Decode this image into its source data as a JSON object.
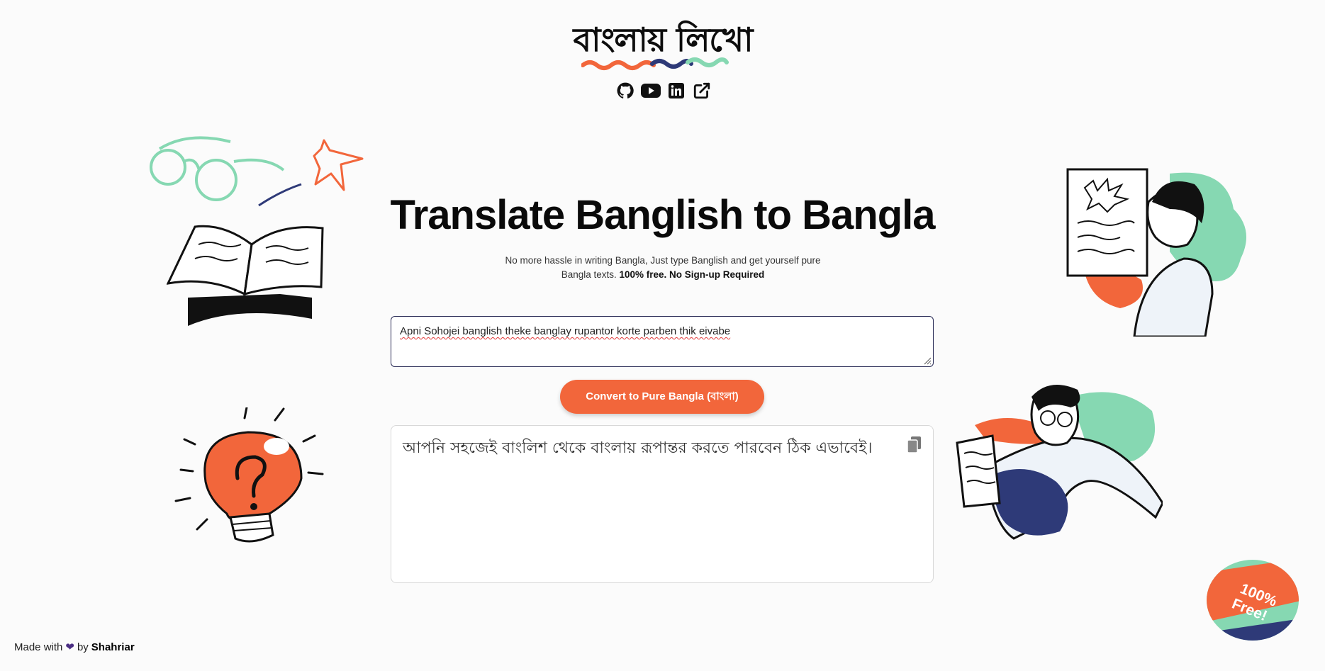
{
  "header": {
    "logo_text": "বাংলায় লিখো",
    "social": [
      {
        "icon": "github-icon"
      },
      {
        "icon": "youtube-icon"
      },
      {
        "icon": "linkedin-icon"
      },
      {
        "icon": "external-link-icon"
      }
    ]
  },
  "main": {
    "title": "Translate Banglish to Bangla",
    "subtitle_plain": "No more hassle in writing Bangla, Just type Banglish and get yourself pure Bangla texts.",
    "subtitle_bold": "100% free. No Sign-up Required",
    "input": {
      "value": "Apni Sohojei banglish theke banglay rupantor korte parben thik eivabe"
    },
    "convert_button": "Convert to Pure Bangla (বাংলা)",
    "output": {
      "value": "আপনি সহজেই বাংলিশ থেকে বাংলায় রূপান্তর করতে পারবেন ঠিক এভাবেই।"
    }
  },
  "badge": {
    "line1": "100%",
    "line2": "Free!"
  },
  "footer": {
    "made_with": "Made with",
    "by": "by",
    "author": "Shahriar"
  },
  "colors": {
    "accent": "#f2663b",
    "mint": "#86d8b2",
    "navy": "#2e3a78",
    "text": "#0a0a0a"
  }
}
